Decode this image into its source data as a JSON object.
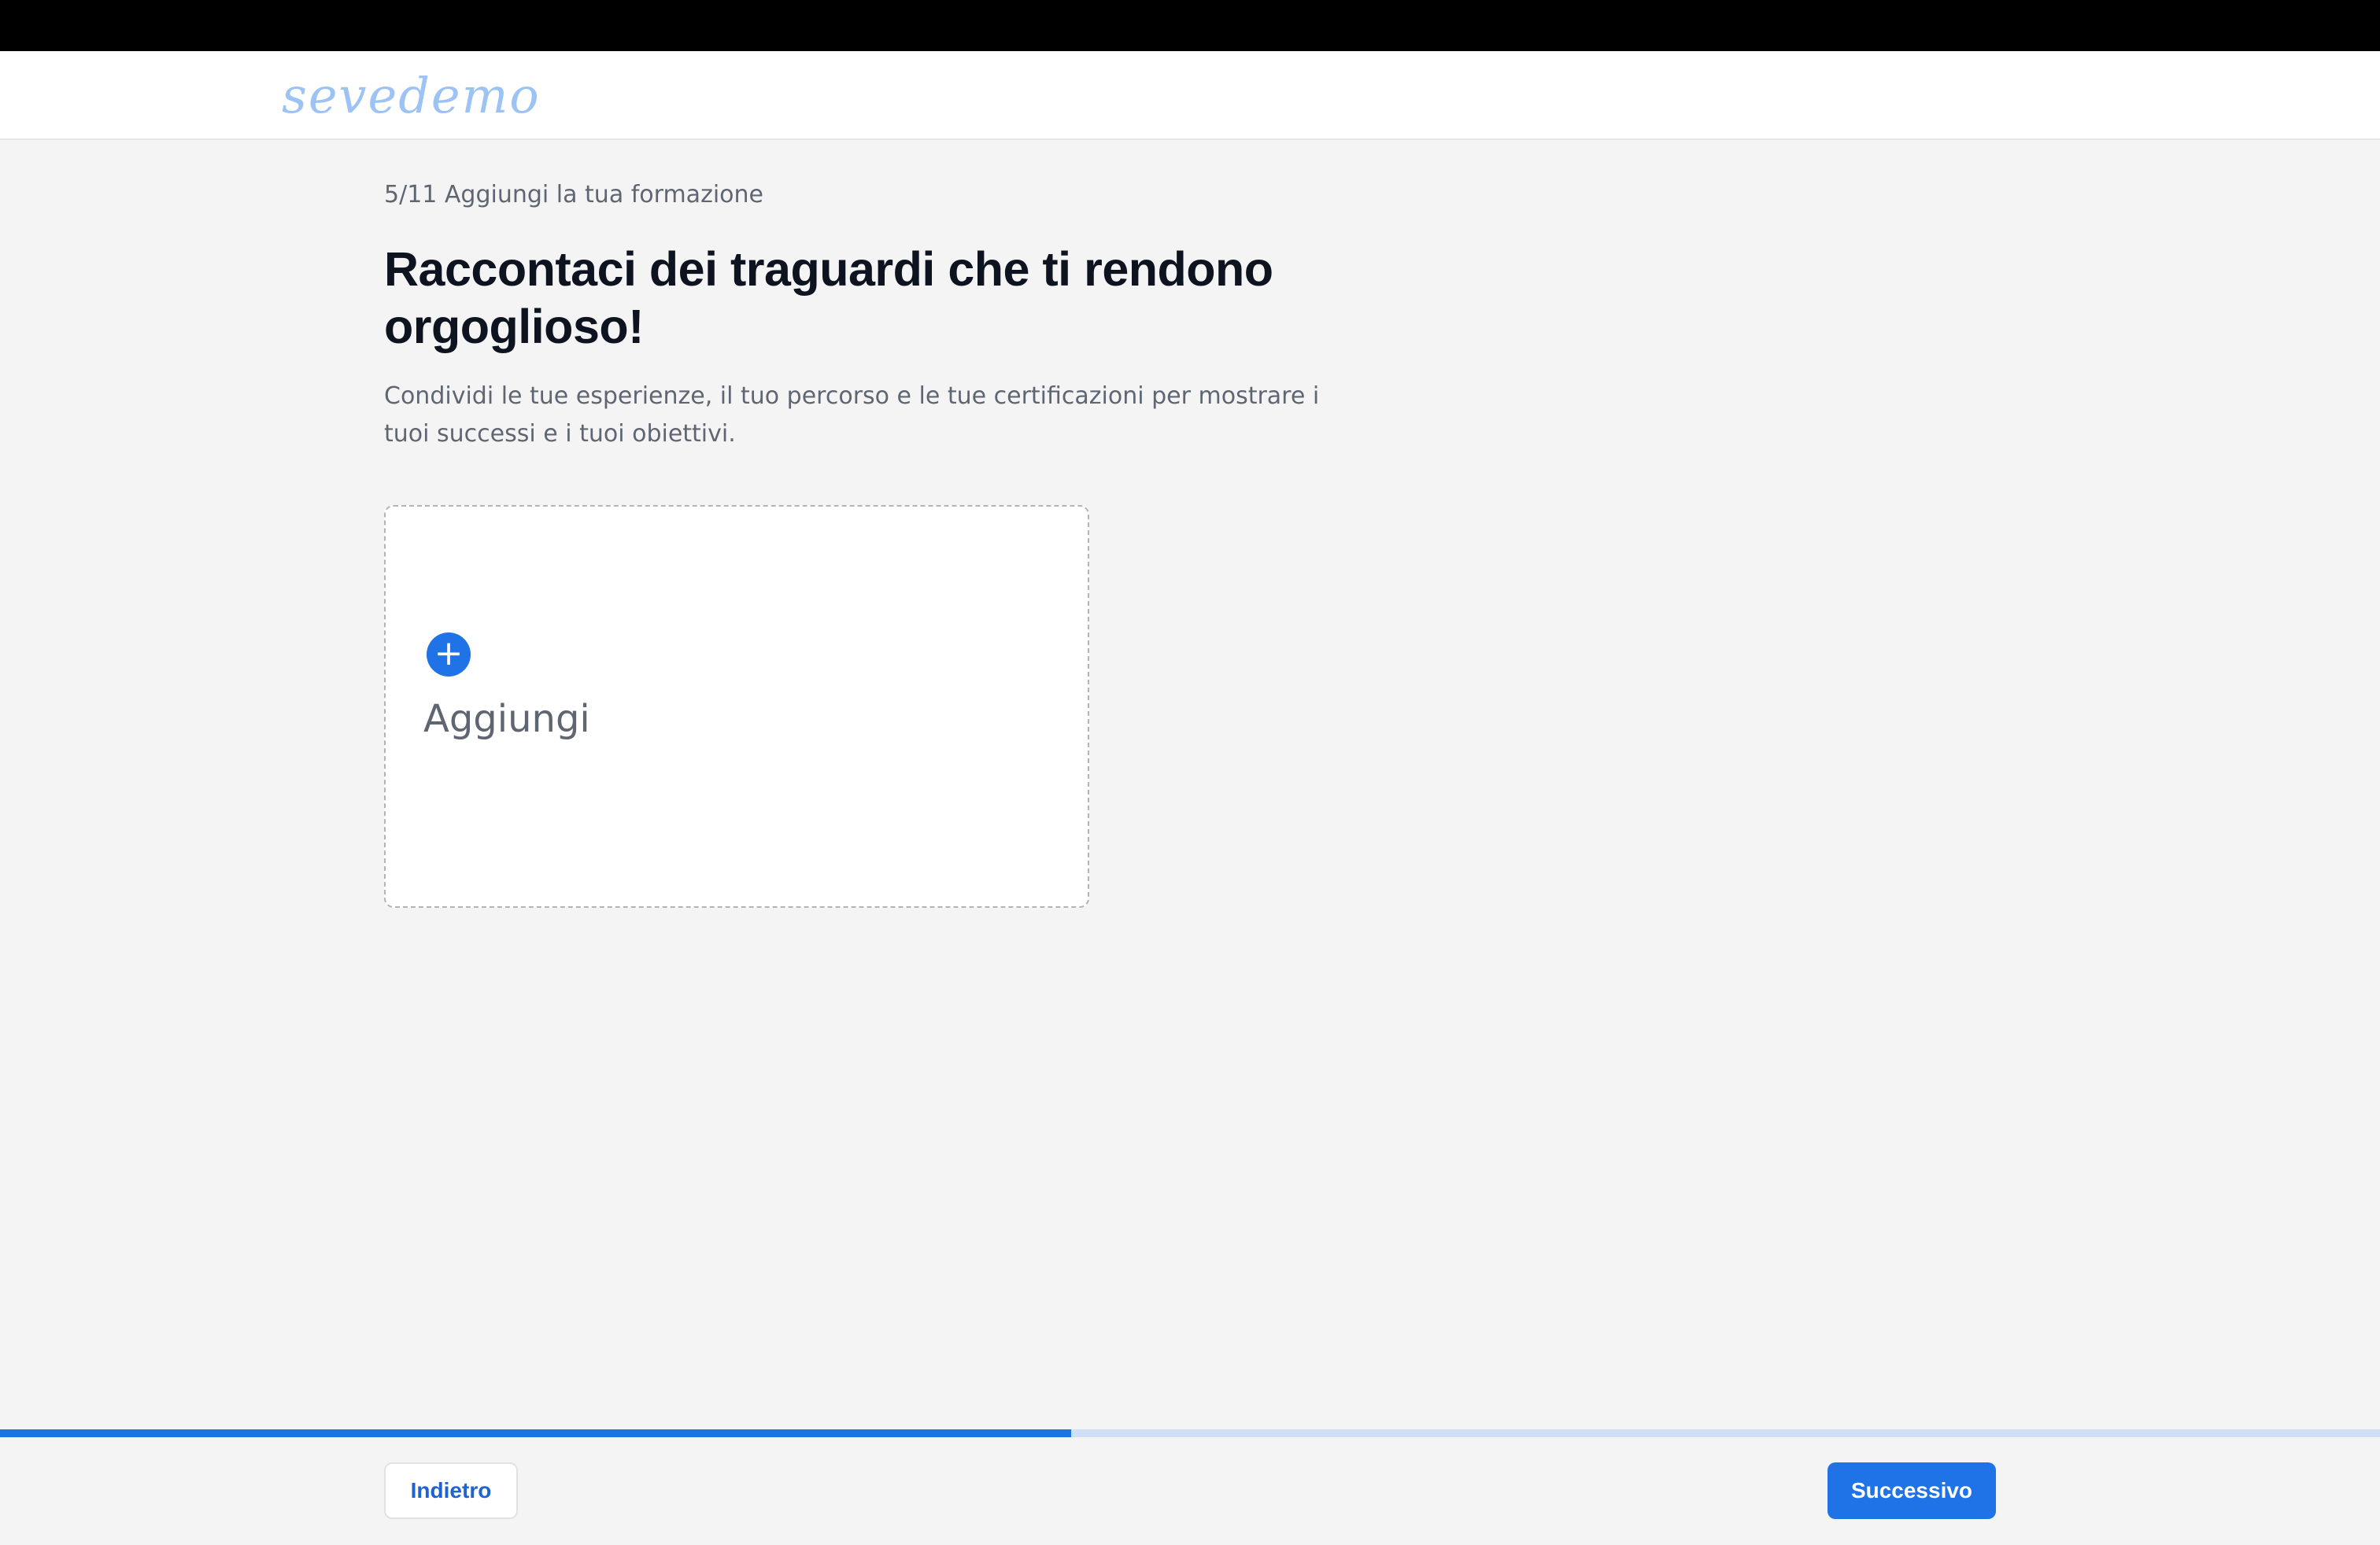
{
  "header": {
    "logo_text": "sevedemo"
  },
  "step": {
    "label": "5/11 Aggiungi la tua formazione",
    "current": 5,
    "total": 11
  },
  "main": {
    "title": "Raccontaci dei traguardi che ti rendono orgoglioso!",
    "description": "Condividi le tue esperienze, il tuo percorso e le tue certificazioni per mostrare i tuoi successi e i tuoi obiettivi."
  },
  "add_card": {
    "label": "Aggiungi",
    "icon": "plus-icon"
  },
  "progress": {
    "fraction": 0.45
  },
  "footer": {
    "back_label": "Indietro",
    "next_label": "Successivo"
  },
  "colors": {
    "accent": "#1f73e6",
    "logo": "#9cc3f3",
    "page_background": "#f4f4f5",
    "progress_track": "#cfdff6"
  }
}
